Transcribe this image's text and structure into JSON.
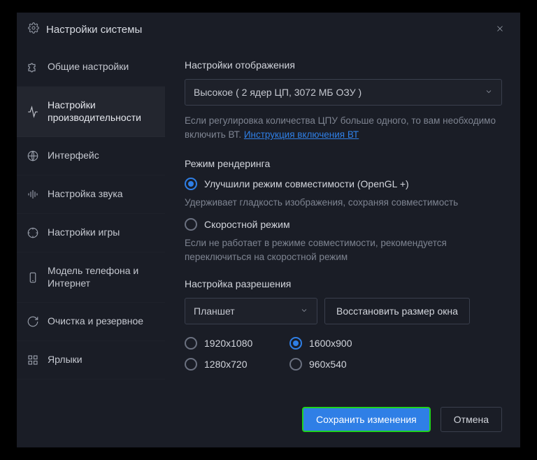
{
  "window": {
    "title": "Настройки системы"
  },
  "sidebar": {
    "items": [
      {
        "label": "Общие настройки"
      },
      {
        "label": "Настройки производительности"
      },
      {
        "label": "Интерфейс"
      },
      {
        "label": "Настройка звука"
      },
      {
        "label": "Настройки игры"
      },
      {
        "label": "Модель телефона и Интернет"
      },
      {
        "label": "Очистка и резервное"
      },
      {
        "label": "Ярлыки"
      }
    ]
  },
  "display": {
    "title": "Настройки отображения",
    "selected": "Высокое ( 2 ядер ЦП, 3072 МБ ОЗУ )",
    "hint_text": "Если регулировка количества ЦПУ больше одного, то вам необходимо включить ВТ. ",
    "hint_link": "Инструкция включения ВТ"
  },
  "render": {
    "title": "Режим рендеринга",
    "opt1": "Улучшили режим совместимости (OpenGL +)",
    "opt1_desc": "Удерживает гладкость изображения, сохраняя совместимость",
    "opt2": "Скоростной режим",
    "opt2_desc": "Если не работает в режиме совместимости, рекомендуется переключиться на скоростной режим"
  },
  "resolution": {
    "title": "Настройка разрешения",
    "mode": "Планшет",
    "reset": "Восстановить размер окна",
    "opts": [
      "1920x1080",
      "1600x900",
      "1280x720",
      "960x540"
    ],
    "selected": "1600x900"
  },
  "footer": {
    "save": "Сохранить изменения",
    "cancel": "Отмена"
  }
}
